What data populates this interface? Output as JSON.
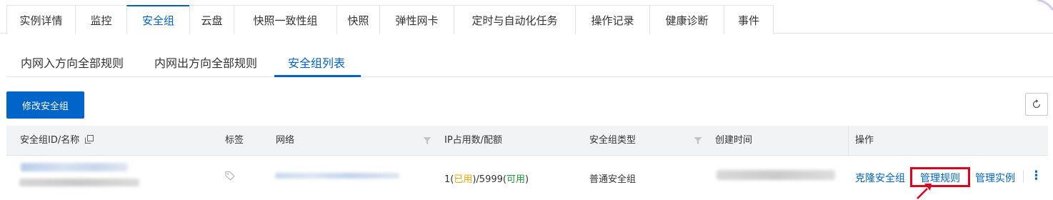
{
  "top_tabs": [
    {
      "label": "实例详情",
      "active": false
    },
    {
      "label": "监控",
      "active": false
    },
    {
      "label": "安全组",
      "active": true
    },
    {
      "label": "云盘",
      "active": false
    },
    {
      "label": "快照一致性组",
      "active": false
    },
    {
      "label": "快照",
      "active": false
    },
    {
      "label": "弹性网卡",
      "active": false
    },
    {
      "label": "定时与自动化任务",
      "active": false
    },
    {
      "label": "操作记录",
      "active": false
    },
    {
      "label": "健康诊断",
      "active": false
    },
    {
      "label": "事件",
      "active": false
    }
  ],
  "sub_tabs": [
    {
      "label": "内网入方向全部规则",
      "active": false
    },
    {
      "label": "内网出方向全部规则",
      "active": false
    },
    {
      "label": "安全组列表",
      "active": true
    }
  ],
  "toolbar": {
    "modify_label": "修改安全组",
    "refresh_icon": "refresh-icon"
  },
  "table": {
    "headers": {
      "id_name": "安全组ID/名称",
      "tags": "标签",
      "network": "网络",
      "ip_usage": "IP占用数/配额",
      "sg_type": "安全组类型",
      "created": "创建时间",
      "ops": "操作"
    },
    "row": {
      "ip_used_count": "1(",
      "ip_used_word": "已用",
      "ip_mid": ")/5999(",
      "ip_avail_word": "可用",
      "ip_end": ")",
      "sg_type": "普通安全组",
      "ops": {
        "clone": "克隆安全组",
        "manage_rules": "管理规则",
        "manage_instances": "管理实例",
        "more": "⋮"
      }
    }
  },
  "colors": {
    "brand": "#0064c8",
    "used": "#e6a700",
    "available": "#1a9c37",
    "highlight": "#e1001e"
  }
}
